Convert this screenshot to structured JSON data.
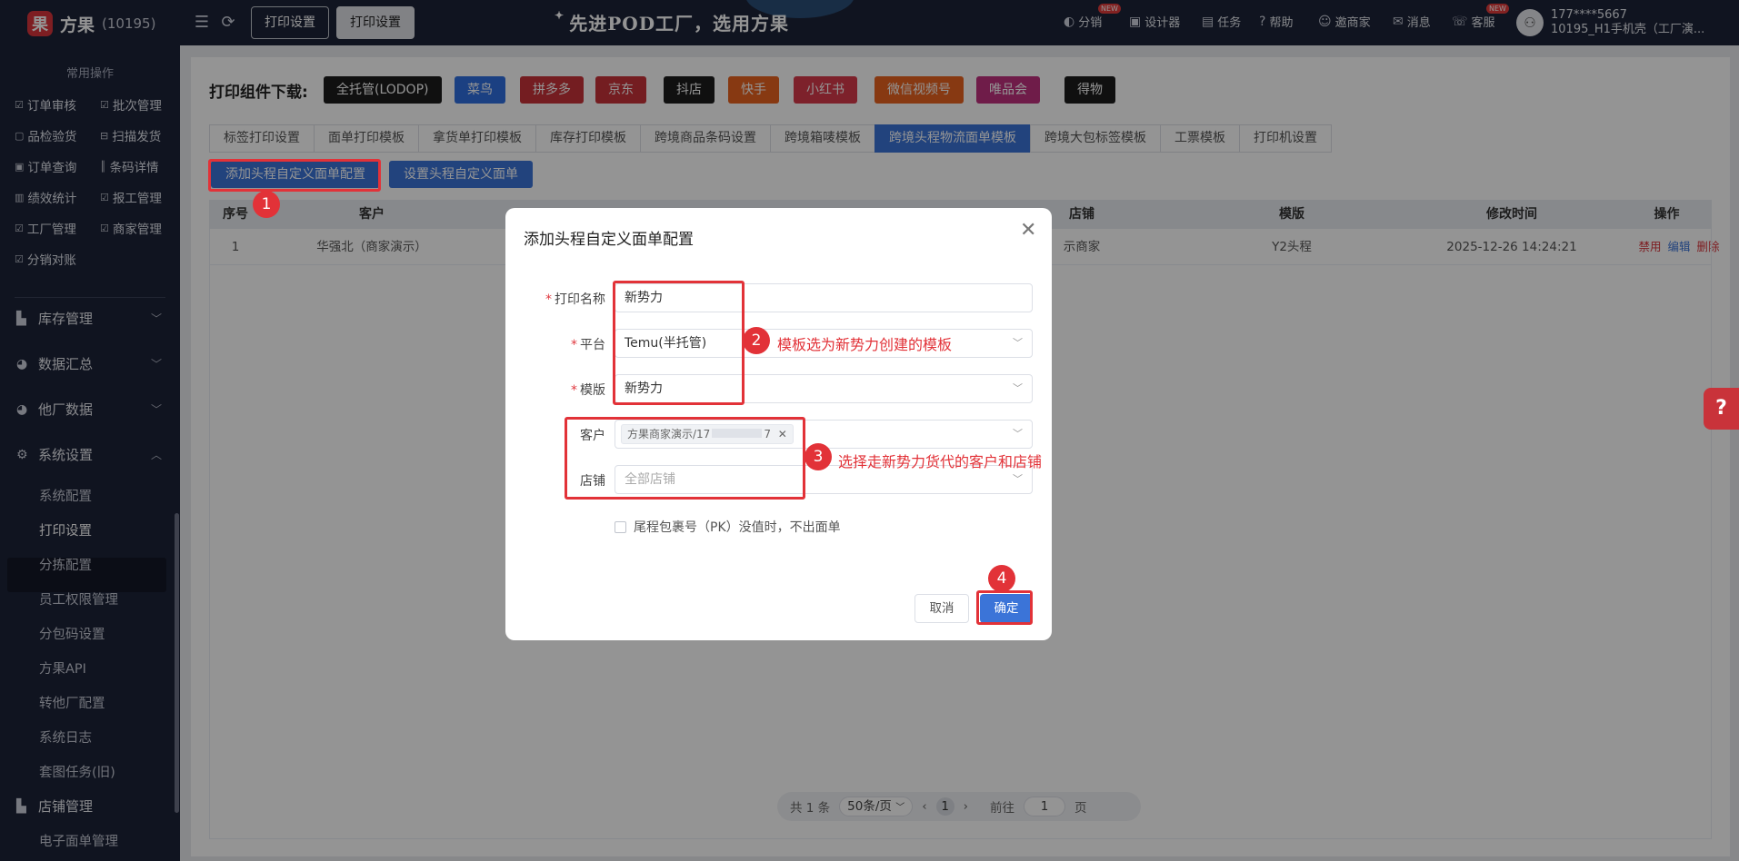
{
  "brand": {
    "logo_char": "果",
    "name": "方果",
    "id": "(10195)"
  },
  "top_tabs": [
    "打印设置",
    "打印设置"
  ],
  "slogan": "先进POD工厂，选用方果",
  "top_links": {
    "fenxiao": "分销",
    "designer": "设计器",
    "task": "任务",
    "help": "帮助",
    "invite": "邀商家",
    "message": "消息",
    "service": "客服",
    "new_badge": "NEW"
  },
  "user": {
    "phone": "177****5667",
    "org": "10195_H1手机壳（工厂演..."
  },
  "sidebar": {
    "section_title": "常用操作",
    "quick": [
      {
        "label": "订单审核"
      },
      {
        "label": "批次管理"
      },
      {
        "label": "品检验货"
      },
      {
        "label": "扫描发货"
      },
      {
        "label": "订单查询"
      },
      {
        "label": "条码详情"
      },
      {
        "label": "绩效统计"
      },
      {
        "label": "报工管理"
      },
      {
        "label": "工厂管理"
      },
      {
        "label": "商家管理"
      },
      {
        "label": "分销对账"
      }
    ],
    "groups": [
      "库存管理",
      "数据汇总",
      "他厂数据",
      "系统设置",
      "店铺管理"
    ],
    "sub_items": [
      "系统配置",
      "打印设置",
      "分拣配置",
      "员工权限管理",
      "分包码设置",
      "方果API",
      "转他厂配置",
      "系统日志",
      "套图任务(旧)",
      "电子面单管理"
    ]
  },
  "download": {
    "label": "打印组件下载:",
    "buttons": [
      {
        "label": "全托管(LODOP)",
        "color": "#1c1c1c"
      },
      {
        "label": "菜鸟",
        "color": "#2f6fe0"
      },
      {
        "label": "拼多多",
        "color": "#c9333a"
      },
      {
        "label": "京东",
        "color": "#c9333a"
      },
      {
        "label": "抖店",
        "color": "#1c1c1c"
      },
      {
        "label": "快手",
        "color": "#e8631f"
      },
      {
        "label": "小红书",
        "color": "#d83a4a"
      },
      {
        "label": "微信视频号",
        "color": "#e8631f"
      },
      {
        "label": "唯品会",
        "color": "#c0317f"
      },
      {
        "label": "得物",
        "color": "#1c1c1c"
      }
    ]
  },
  "tabs": [
    "标签打印设置",
    "面单打印模板",
    "拿货单打印模板",
    "库存打印模板",
    "跨境商品条码设置",
    "跨境箱唛模板",
    "跨境头程物流面单模板",
    "跨境大包标签模板",
    "工票模板",
    "打印机设置"
  ],
  "actions": {
    "add": "添加头程自定义面单配置",
    "set": "设置头程自定义面单"
  },
  "table": {
    "headers": {
      "no": "序号",
      "customer": "客户",
      "shop": "店铺",
      "template": "模版",
      "modified": "修改时间",
      "ops": "操作"
    },
    "row": {
      "no": "1",
      "customer": "华强北（商家演示）",
      "shop": "示商家",
      "template": "Y2头程",
      "modified": "2025-12-26 14:24:21",
      "disable": "禁用",
      "edit": "编辑",
      "delete": "删除"
    }
  },
  "pager": {
    "total": "共 1 条",
    "size": "50条/页",
    "page": "1",
    "goto": "前往",
    "goto_val": "1",
    "unit": "页"
  },
  "dialog": {
    "title": "添加头程自定义面单配置",
    "print_name_label": "打印名称",
    "print_name": "新势力",
    "platform_label": "平台",
    "platform": "Temu(半托管)",
    "template_label": "模版",
    "template": "新势力",
    "customer_label": "客户",
    "customer_tag": "方果商家演示/17",
    "customer_tag_tail": "7",
    "shop_label": "店铺",
    "shop_placeholder": "全部店铺",
    "checkbox_label": "尾程包裹号（PK）没值时，不出面单",
    "cancel": "取消",
    "ok": "确定"
  },
  "annotations": {
    "n1": "1",
    "n2": "2",
    "n3": "3",
    "n4": "4",
    "note2": "模板选为新势力创建的模板",
    "note3": "选择走新势力货代的客户和店铺"
  }
}
